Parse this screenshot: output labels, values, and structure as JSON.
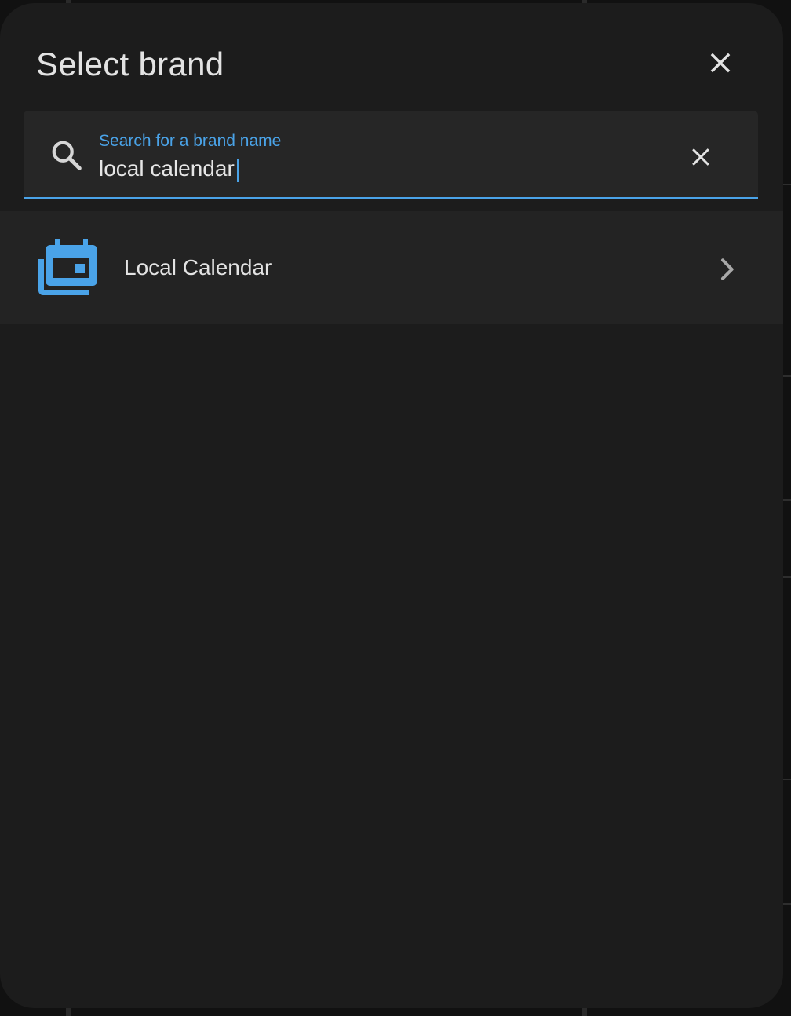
{
  "dialog": {
    "title": "Select brand",
    "close_icon": "close-icon"
  },
  "search": {
    "label": "Search for a brand name",
    "value": "local calendar",
    "search_icon": "search-icon",
    "clear_icon": "close-icon"
  },
  "results": [
    {
      "label": "Local Calendar",
      "icon": "calendar-multiple-icon",
      "trailing_icon": "chevron-right-icon"
    }
  ],
  "colors": {
    "accent": "#4aa3e8",
    "dialog_background": "#1c1c1c",
    "item_background": "#232323",
    "text_primary": "#e3e3e3"
  }
}
